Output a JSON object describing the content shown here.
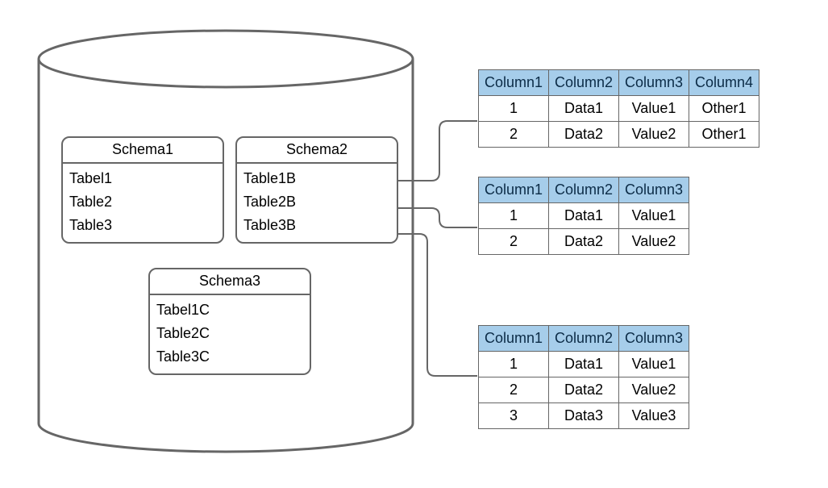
{
  "schemas": [
    {
      "title": "Schema1",
      "tables": [
        "Tabel1",
        "Table2",
        "Table3"
      ]
    },
    {
      "title": "Schema2",
      "tables": [
        "Table1B",
        "Table2B",
        "Table3B"
      ]
    },
    {
      "title": "Schema3",
      "tables": [
        "Tabel1C",
        "Table2C",
        "Table3C"
      ]
    }
  ],
  "dataTables": [
    {
      "headers": [
        "Column1",
        "Column2",
        "Column3",
        "Column4"
      ],
      "rows": [
        [
          "1",
          "Data1",
          "Value1",
          "Other1"
        ],
        [
          "2",
          "Data2",
          "Value2",
          "Other1"
        ]
      ]
    },
    {
      "headers": [
        "Column1",
        "Column2",
        "Column3"
      ],
      "rows": [
        [
          "1",
          "Data1",
          "Value1"
        ],
        [
          "2",
          "Data2",
          "Value2"
        ]
      ]
    },
    {
      "headers": [
        "Column1",
        "Column2",
        "Column3"
      ],
      "rows": [
        [
          "1",
          "Data1",
          "Value1"
        ],
        [
          "2",
          "Data2",
          "Value2"
        ],
        [
          "3",
          "Data3",
          "Value3"
        ]
      ]
    }
  ]
}
